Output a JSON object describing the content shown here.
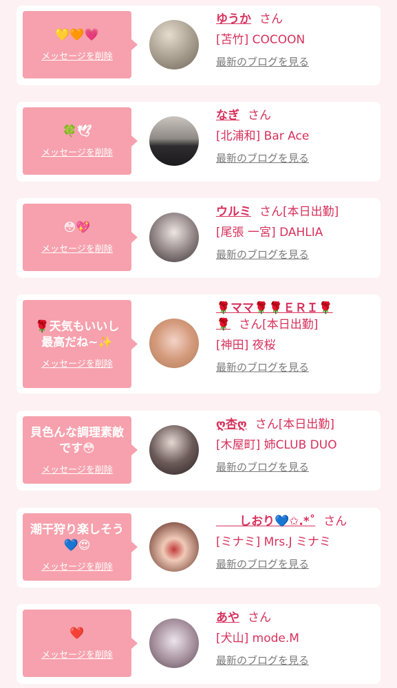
{
  "cards": [
    {
      "message": "💛🧡💗",
      "delete_label": "メッセージを削除",
      "name": "ゆうか",
      "honorific": "さん",
      "status": "",
      "shop": "[苫竹] COCOON",
      "blog_label": "最新のブログを見る",
      "avatar_colors": [
        "#e6dccd",
        "#6f6558"
      ]
    },
    {
      "message": "🍀🕊",
      "delete_label": "メッセージを削除",
      "name": "なぎ",
      "honorific": "さん",
      "status": "",
      "shop": "[北浦和] Bar Ace",
      "blog_label": "最新のブログを見る",
      "avatar_colors": [
        "#c9c4be",
        "#2e2c2e"
      ]
    },
    {
      "message": "😳💖",
      "delete_label": "メッセージを削除",
      "name": "ウルミ",
      "honorific": "さん",
      "status": "[本日出勤]",
      "shop": "[尾張 一宮] DAHLIA",
      "blog_label": "最新のブログを見る",
      "avatar_colors": [
        "#ede6e2",
        "#3b3536"
      ]
    },
    {
      "message": "🌹天気もいいし\n最高だね~✨",
      "delete_label": "メッセージを削除",
      "name": "🌹ママ🌹🌹ＥＲＩ🌹\n🌹",
      "honorific": "さん",
      "status": "[本日出勤]",
      "shop": "[神田] 夜桜",
      "blog_label": "最新のブログを見る",
      "avatar_colors": [
        "#f3d3c8",
        "#b07d58"
      ]
    },
    {
      "message": "貝色んな調理素敵\nです😳",
      "delete_label": "メッセージを削除",
      "name": "ღ杏ღ",
      "honorific": "さん",
      "status": "[本日出勤]",
      "shop": "[木屋町] 姉CLUB DUO",
      "blog_label": "最新のブログを見る",
      "avatar_colors": [
        "#e4d8d2",
        "#2a2223"
      ]
    },
    {
      "message": "潮干狩り楽しそう\n💙😍",
      "delete_label": "メッセージを削除",
      "name": "　　しおり💙✩.*˚",
      "honorific": "さん",
      "status": "",
      "shop": "[ミナミ] Mrs.J ミナミ",
      "blog_label": "最新のブログを見る",
      "avatar_colors": [
        "#f0cab8",
        "#c23a3a"
      ]
    },
    {
      "message": "❤️",
      "delete_label": "メッセージを削除",
      "name": "あや",
      "honorific": "さん",
      "status": "",
      "shop": "[犬山] mode.M",
      "blog_label": "最新のブログを見る",
      "avatar_colors": [
        "#ece4ee",
        "#5a4a55"
      ]
    }
  ]
}
